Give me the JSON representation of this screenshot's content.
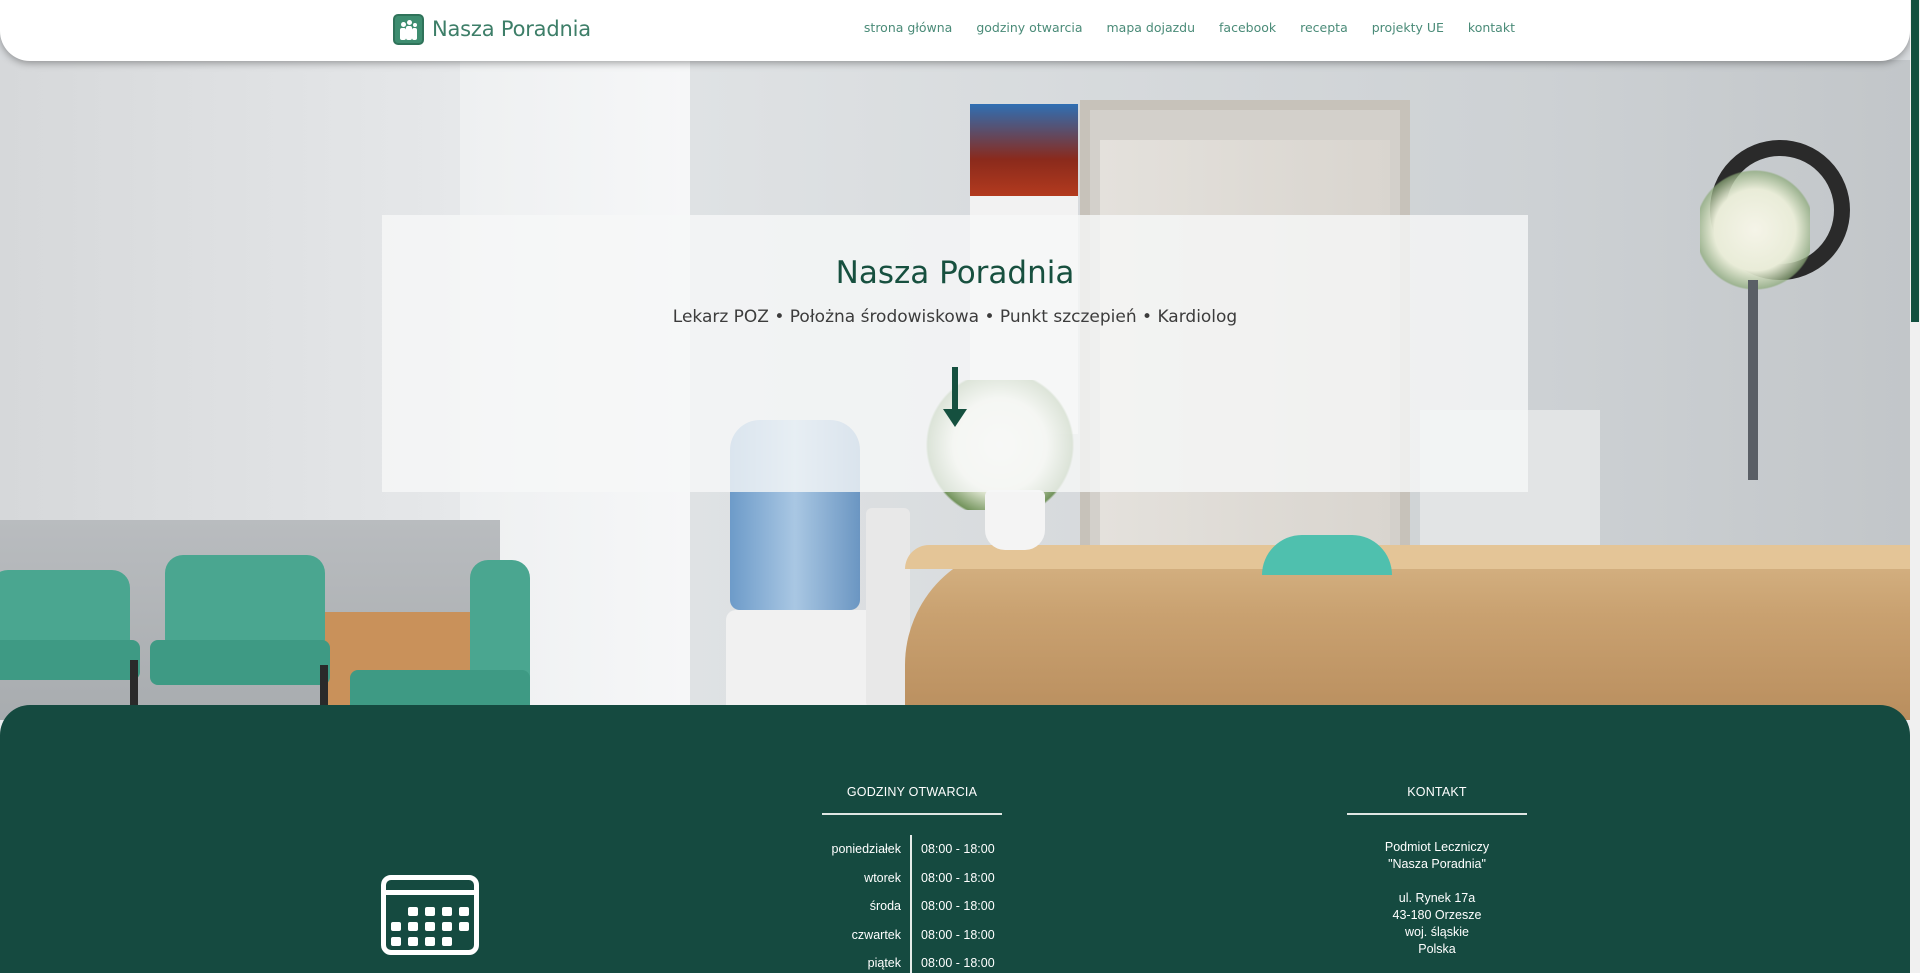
{
  "header": {
    "logo_text": "Nasza Poradnia",
    "nav": [
      {
        "label": "strona główna"
      },
      {
        "label": "godziny otwarcia"
      },
      {
        "label": "mapa dojazdu"
      },
      {
        "label": "facebook"
      },
      {
        "label": "recepta"
      },
      {
        "label": "projekty UE"
      },
      {
        "label": "kontakt"
      }
    ]
  },
  "hero": {
    "title": "Nasza Poradnia",
    "subtitle": "Lekarz POZ • Położna środowiskowa • Punkt szczepień • Kardiolog",
    "arrow_icon": "arrow-down-icon"
  },
  "footer": {
    "calendar_icon": "calendar-icon",
    "hours": {
      "heading": "GODZINY OTWARCIA",
      "rows": [
        {
          "day": "poniedziałek",
          "time": "08:00 - 18:00"
        },
        {
          "day": "wtorek",
          "time": "08:00 - 18:00"
        },
        {
          "day": "środa",
          "time": "08:00 - 18:00"
        },
        {
          "day": "czwartek",
          "time": "08:00 - 18:00"
        },
        {
          "day": "piątek",
          "time": "08:00 - 18:00"
        }
      ]
    },
    "contact": {
      "heading": "KONTAKT",
      "line1": "Podmiot Leczniczy",
      "line2": "\"Nasza Poradnia\"",
      "line3": "ul. Rynek 17a",
      "line4": "43-180 Orzesze",
      "line5": "woj. śląskie",
      "line6": "Polska"
    }
  },
  "colors": {
    "brand_green": "#154a40",
    "nav_text": "#4a8b78",
    "title_green": "#17503f"
  }
}
